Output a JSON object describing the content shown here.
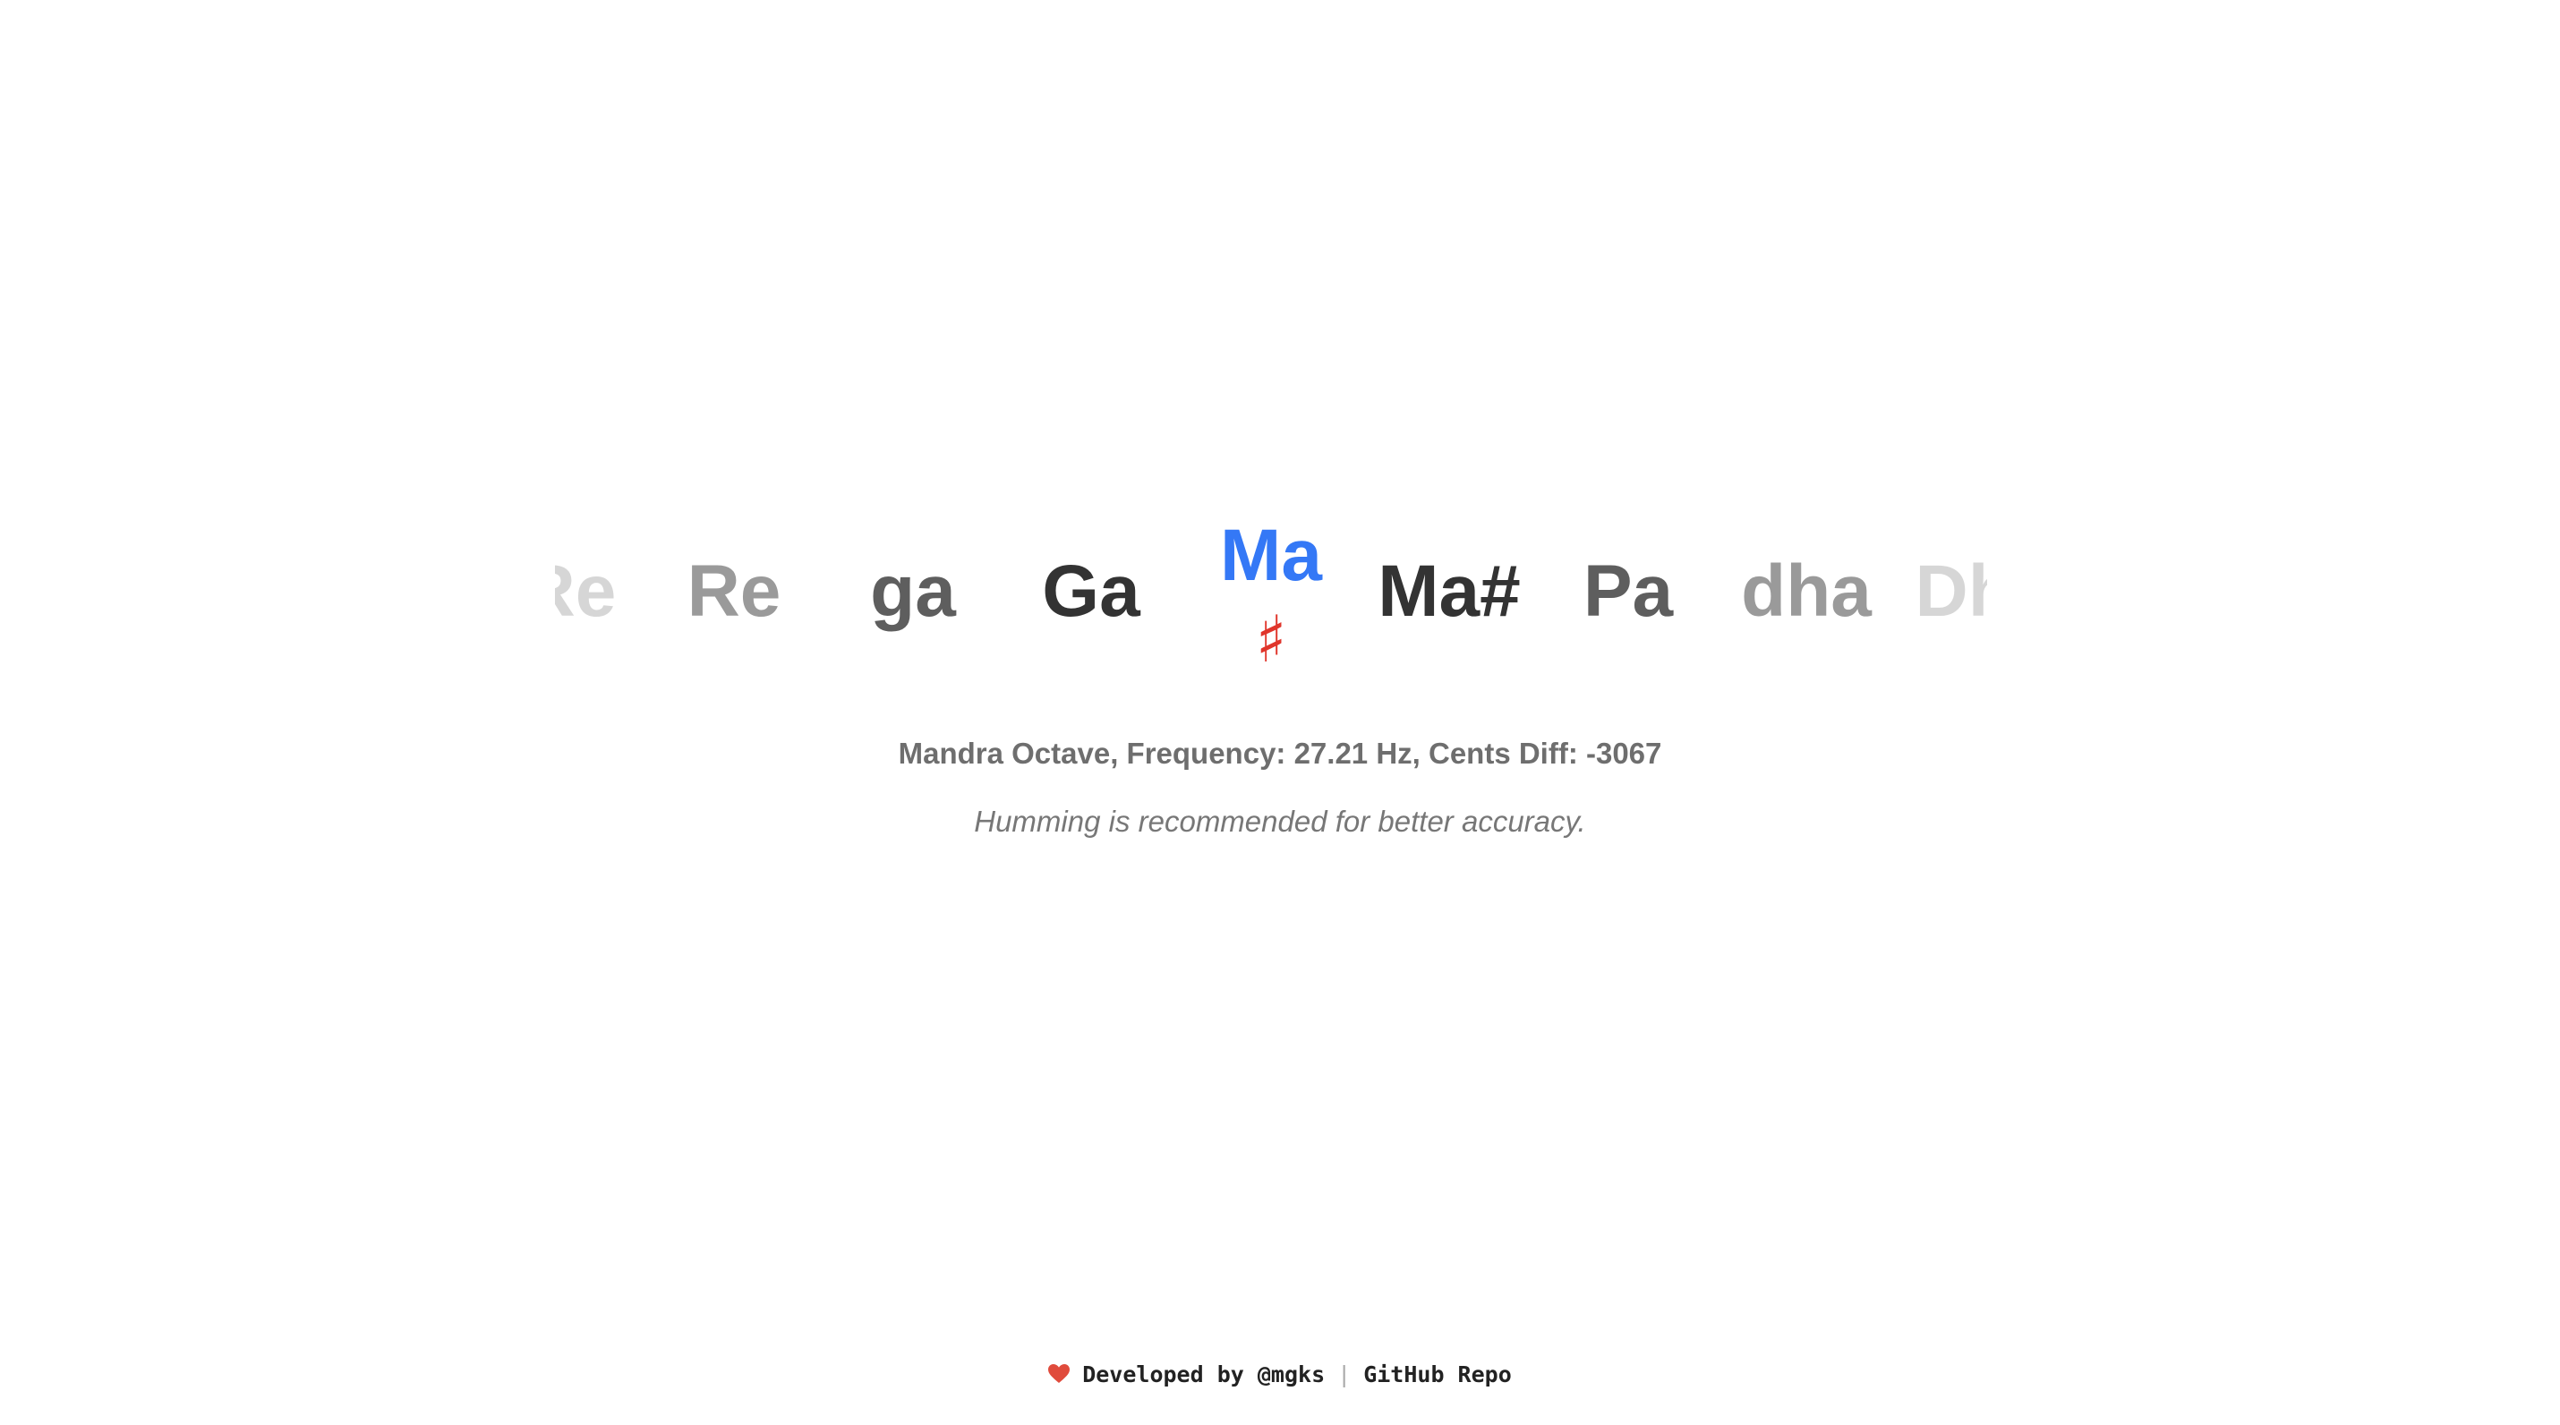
{
  "colors": {
    "active_note": "#3478f6",
    "sharp_mark": "#e0352b",
    "info_text": "#6e6e6e",
    "hint_text": "#777777",
    "footer_text": "#222222",
    "separator": "#aaaaaa",
    "heart": "#e04b3c"
  },
  "notes": [
    {
      "label": "Re",
      "color": "#d6d6d6",
      "center": 16
    },
    {
      "label": "Re",
      "color": "#9a9a9a",
      "center": 200
    },
    {
      "label": "ga",
      "color": "#5e5e5e",
      "center": 400
    },
    {
      "label": "Ga",
      "color": "#333333",
      "center": 599
    },
    {
      "label": "Ma#",
      "color": "#333333",
      "center": 999
    },
    {
      "label": "Pa",
      "color": "#5e5e5e",
      "center": 1199
    },
    {
      "label": "dha",
      "color": "#9a9a9a",
      "center": 1398
    },
    {
      "label": "Dha",
      "color": "#d6d6d6",
      "center": 1597
    }
  ],
  "active_note": {
    "label": "Ma",
    "sharp_symbol": "♯"
  },
  "info": {
    "text": "Mandra Octave, Frequency: 27.21 Hz, Cents Diff: -3067"
  },
  "hint": {
    "text": "Humming is recommended for better accuracy."
  },
  "footer": {
    "developed_by": "Developed by @mgks",
    "separator": "|",
    "repo_link": "GitHub Repo",
    "heart_icon": "heart-icon"
  }
}
